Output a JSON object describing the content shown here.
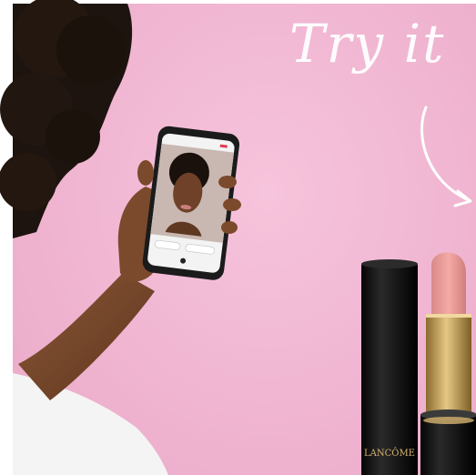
{
  "headline": "Try it",
  "brand": "LANCÔME",
  "colors": {
    "background_pink": "#f2b8d4",
    "headline_white": "#ffffff",
    "lipstick_shade": "#f0a0a0",
    "case_black": "#111111",
    "gold_band": "#c8a25c"
  },
  "icons": [
    "curved-arrow-icon",
    "phone-camera-screen"
  ]
}
